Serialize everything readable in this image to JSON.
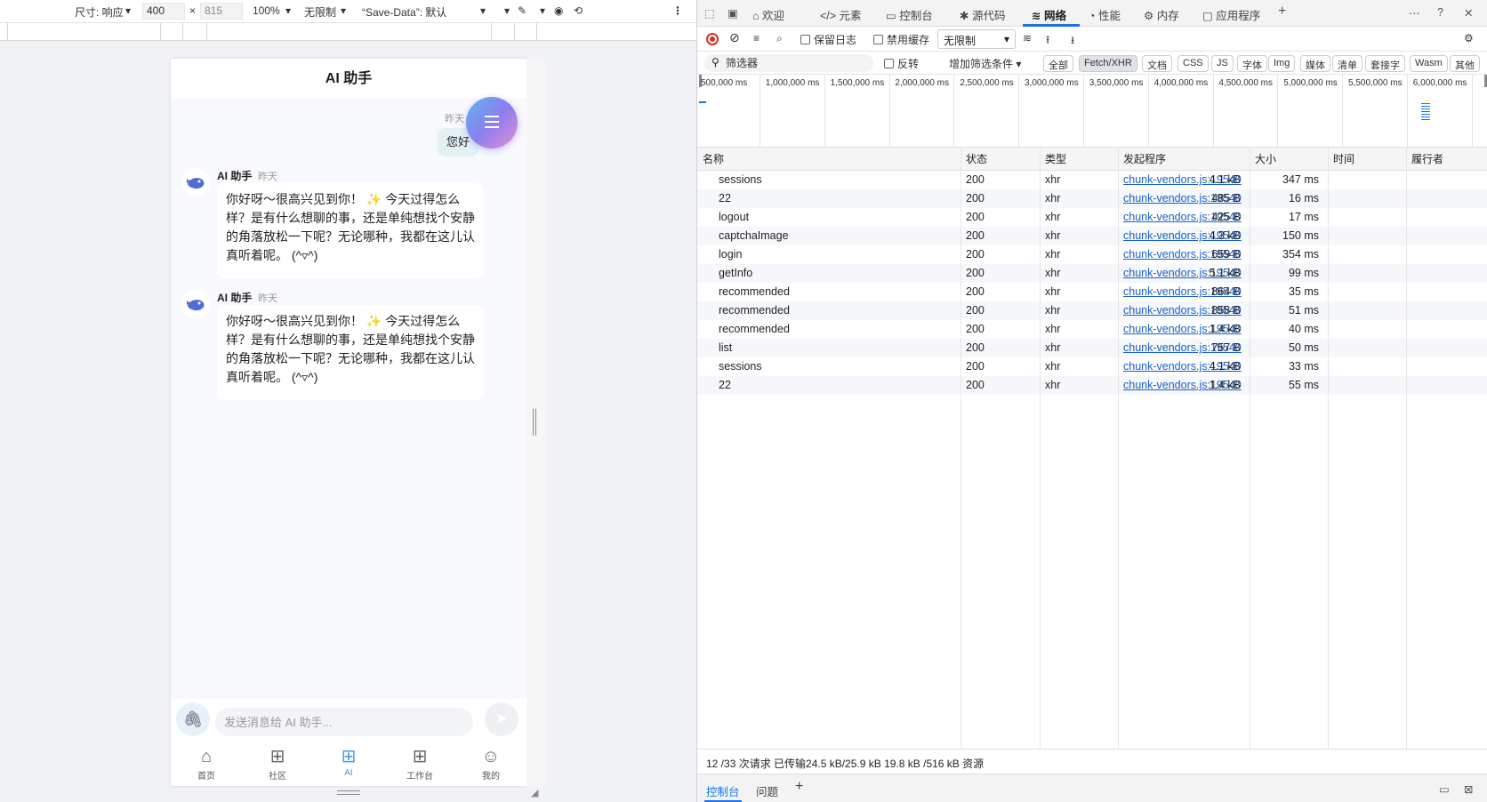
{
  "device_toolbar": {
    "dimensions_label": "尺寸: 响应",
    "width": "400",
    "times": "×",
    "height_placeholder": "815",
    "zoom": "100%",
    "throttle": "无限制",
    "save_data": "“Save-Data”: 默认"
  },
  "phone": {
    "title": "AI 助手",
    "user_message": {
      "time": "昨天",
      "text": "您好"
    },
    "ai_messages": [
      {
        "name": "AI 助手",
        "time": "昨天",
        "text": "你好呀～很高兴见到你！ ✨ 今天过得怎么样？是有什么想聊的事，还是单纯想找个安静的角落放松一下呢？无论哪种，我都在这儿认真听着呢。 (^▿^)"
      },
      {
        "name": "AI 助手",
        "time": "昨天",
        "text": "你好呀～很高兴见到你！ ✨ 今天过得怎么样？是有什么想聊的事，还是单纯想找个安静的角落放松一下呢？无论哪种，我都在这儿认真听着呢。 (^▿^)"
      }
    ],
    "input_placeholder": "发送消息给 AI 助手...",
    "tabs": [
      {
        "label": "首页",
        "icon": "home-icon"
      },
      {
        "label": "社区",
        "icon": "grid-icon"
      },
      {
        "label": "AI",
        "icon": "grid-icon",
        "active": true
      },
      {
        "label": "工作台",
        "icon": "grid-icon"
      },
      {
        "label": "我的",
        "icon": "user-icon"
      }
    ]
  },
  "devtools": {
    "tabs": [
      "欢迎",
      "元素",
      "控制台",
      "源代码",
      "网络",
      "性能",
      "内存",
      "应用程序"
    ],
    "active_tab": "网络",
    "toolbar": {
      "preserve_log": "保留日志",
      "disable_cache": "禁用缓存",
      "throttling": "无限制"
    },
    "filter": {
      "placeholder": "筛选器",
      "invert": "反转",
      "more_filters": "增加筛选条件",
      "chips": [
        "全部",
        "Fetch/XHR",
        "文档",
        "CSS",
        "JS",
        "字体",
        "Img",
        "媒体",
        "清单",
        "套接字",
        "Wasm",
        "其他"
      ],
      "active_chip": "Fetch/XHR"
    },
    "overview_ticks": [
      "500,000 ms",
      "1,000,000 ms",
      "1,500,000 ms",
      "2,000,000 ms",
      "2,500,000 ms",
      "3,000,000 ms",
      "3,500,000 ms",
      "4,000,000 ms",
      "4,500,000 ms",
      "5,000,000 ms",
      "5,500,000 ms",
      "6,000,000 ms"
    ],
    "columns": [
      "名称",
      "状态",
      "类型",
      "发起程序",
      "大小",
      "时间",
      "履行者"
    ],
    "rows": [
      {
        "name": "sessions",
        "status": "200",
        "type": "xhr",
        "initiator": "chunk-vendors.js:19540",
        "size": "4.1 kB",
        "time": "347 ms"
      },
      {
        "name": "22",
        "status": "200",
        "type": "xhr",
        "initiator": "chunk-vendors.js:19540",
        "size": "485 B",
        "time": "16 ms"
      },
      {
        "name": "logout",
        "status": "200",
        "type": "xhr",
        "initiator": "chunk-vendors.js:19540",
        "size": "425 B",
        "time": "17 ms"
      },
      {
        "name": "captchaImage",
        "status": "200",
        "type": "xhr",
        "initiator": "chunk-vendors.js:19540",
        "size": "4.3 kB",
        "time": "150 ms"
      },
      {
        "name": "login",
        "status": "200",
        "type": "xhr",
        "initiator": "chunk-vendors.js:19540",
        "size": "659 B",
        "time": "354 ms"
      },
      {
        "name": "getInfo",
        "status": "200",
        "type": "xhr",
        "initiator": "chunk-vendors.js:19540",
        "size": "5.1 kB",
        "time": "99 ms"
      },
      {
        "name": "recommended",
        "status": "200",
        "type": "xhr",
        "initiator": "chunk-vendors.js:19540",
        "size": "864 B",
        "time": "35 ms"
      },
      {
        "name": "recommended",
        "status": "200",
        "type": "xhr",
        "initiator": "chunk-vendors.js:19540",
        "size": "858 B",
        "time": "51 ms"
      },
      {
        "name": "recommended",
        "status": "200",
        "type": "xhr",
        "initiator": "chunk-vendors.js:19540",
        "size": "1.4 kB",
        "time": "40 ms"
      },
      {
        "name": "list",
        "status": "200",
        "type": "xhr",
        "initiator": "chunk-vendors.js:19540",
        "size": "757 B",
        "time": "50 ms"
      },
      {
        "name": "sessions",
        "status": "200",
        "type": "xhr",
        "initiator": "chunk-vendors.js:19540",
        "size": "4.1 kB",
        "time": "33 ms"
      },
      {
        "name": "22",
        "status": "200",
        "type": "xhr",
        "initiator": "chunk-vendors.js:19540",
        "size": "1.4 kB",
        "time": "55 ms"
      }
    ],
    "status_bar": "12 /33 次请求   已传输24.5 kB/25.9 kB   19.8 kB /516 kB 资源",
    "drawer_tabs": [
      "控制台",
      "问题"
    ],
    "colors": {
      "accent": "#1a73e8",
      "record": "#d93025",
      "link": "#1a5fc4"
    }
  }
}
